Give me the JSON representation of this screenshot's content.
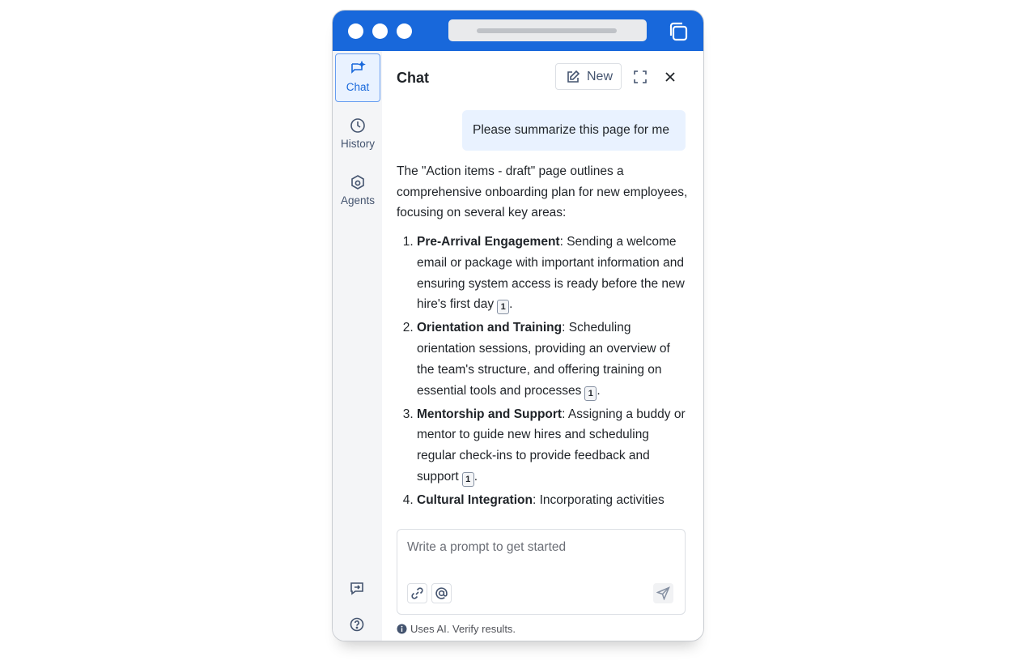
{
  "window": {
    "accent_color": "#1868db",
    "traffic_dots": [
      "window-dot-1",
      "window-dot-2",
      "window-dot-3"
    ],
    "tabs_icon": "copy-icon"
  },
  "sidebar": {
    "items": [
      {
        "label": "Chat",
        "icon": "sparkle-chat-icon",
        "active": true
      },
      {
        "label": "History",
        "icon": "clock-icon",
        "active": false
      },
      {
        "label": "Agents",
        "icon": "agent-hexagon-icon",
        "active": false
      }
    ],
    "bottom_icons": [
      "feedback-icon",
      "help-icon"
    ]
  },
  "header": {
    "title": "Chat",
    "new_label": "New",
    "new_icon": "edit-icon",
    "expand_icon": "expand-icon",
    "close_icon": "close-icon"
  },
  "conversation": {
    "user_message": "Please summarize this page for me",
    "response_intro": "The \"Action items - draft\" page outlines a comprehensive onboarding plan for new employees, focusing on several key areas:",
    "items": [
      {
        "title": "Pre-Arrival Engagement",
        "text": ": Sending a welcome email or package with important information and ensuring system access is ready before the new hire's first day",
        "citation": "1",
        "end": "."
      },
      {
        "title": "Orientation and Training",
        "text": ": Scheduling orientation sessions, providing an overview of the team's structure, and offering training on essential tools and processes",
        "citation": "1",
        "end": "."
      },
      {
        "title": "Mentorship and Support",
        "text": ": Assigning a buddy or mentor to guide new hires and scheduling regular check-ins to provide feedback and support",
        "citation": "1",
        "end": "."
      },
      {
        "title": "Cultural Integration",
        "text": ": Incorporating activities",
        "citation": "",
        "end": ""
      }
    ]
  },
  "composer": {
    "placeholder": "Write a prompt to get started",
    "value": "",
    "link_icon": "link-icon",
    "mention_icon": "at-mention-icon",
    "send_icon": "send-icon"
  },
  "footer": {
    "disclaimer": "Uses AI. Verify results.",
    "info_icon": "info-icon"
  }
}
